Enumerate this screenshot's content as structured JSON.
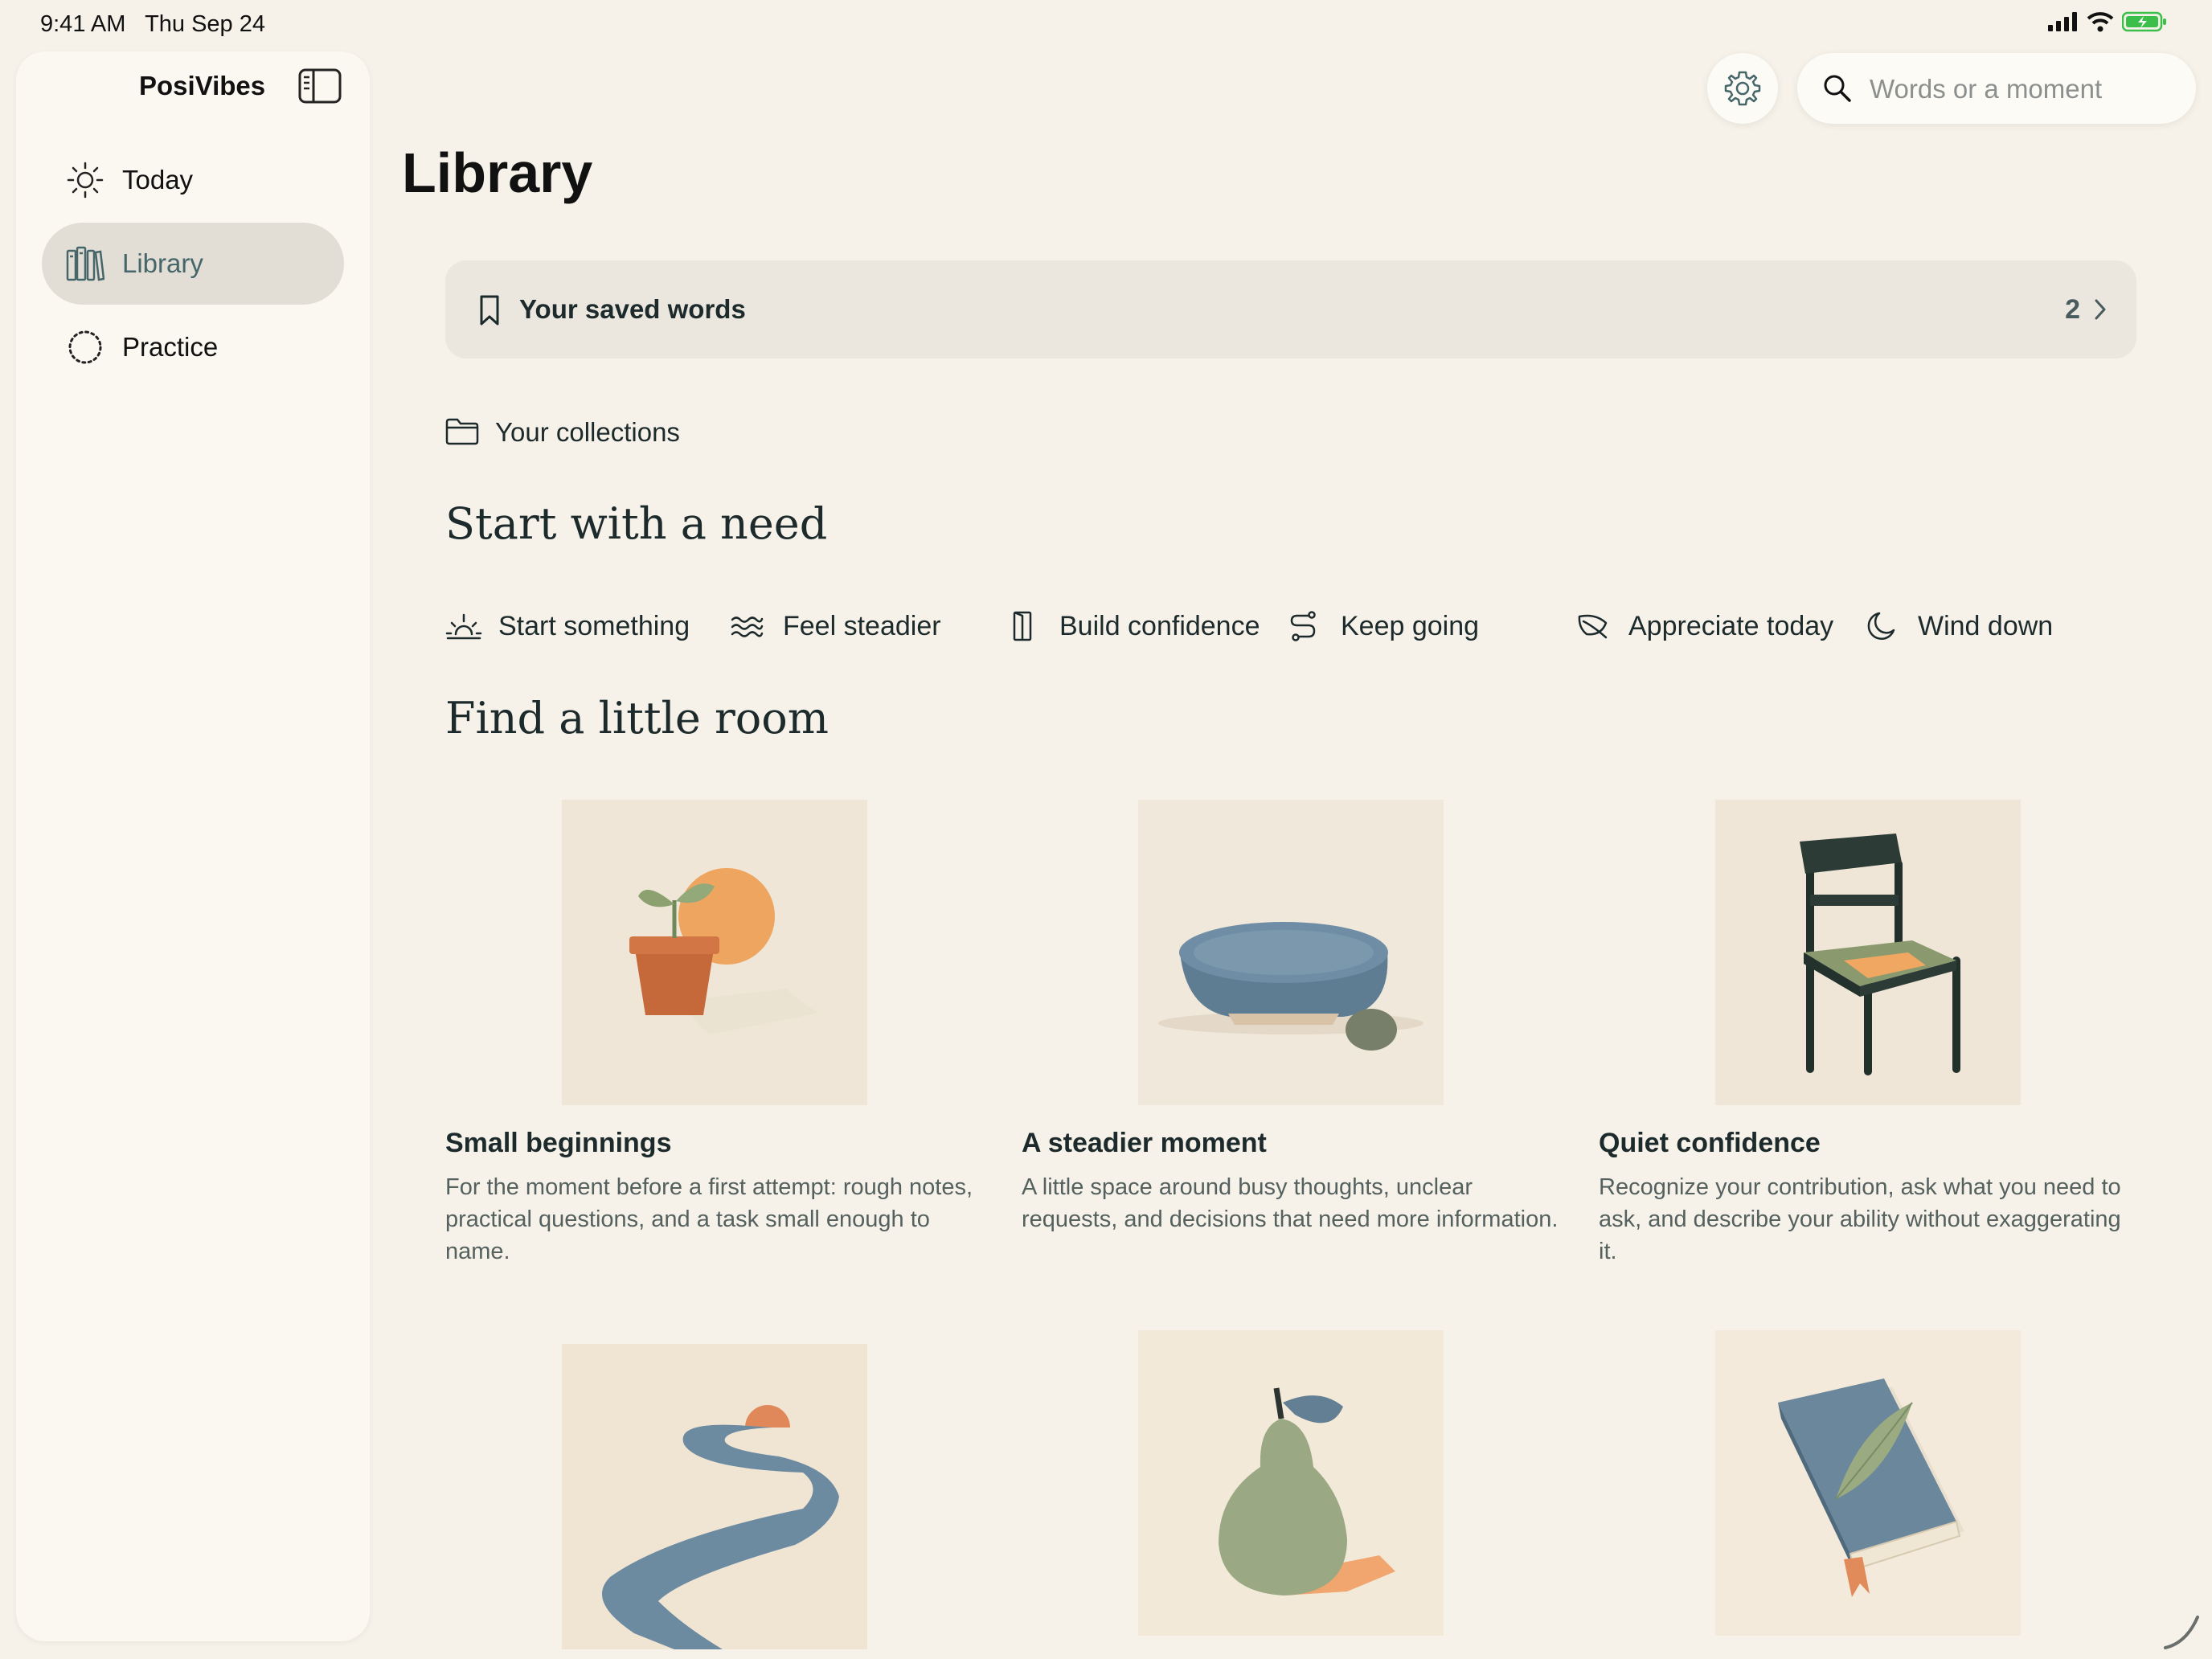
{
  "status_bar": {
    "time": "9:41 AM",
    "date": "Thu Sep 24"
  },
  "sidebar": {
    "app_title": "PosiVibes",
    "items": [
      {
        "label": "Today",
        "icon": "sun-icon"
      },
      {
        "label": "Library",
        "icon": "books-icon",
        "selected": true
      },
      {
        "label": "Practice",
        "icon": "dashed-circle-icon"
      }
    ]
  },
  "search": {
    "placeholder": "Words or a moment"
  },
  "page": {
    "title": "Library"
  },
  "saved_words": {
    "label": "Your saved words",
    "count": "2"
  },
  "collections": {
    "label": "Your collections"
  },
  "needs": {
    "heading": "Start with a need",
    "items": [
      {
        "label": "Start something",
        "icon": "sunrise-icon"
      },
      {
        "label": "Feel steadier",
        "icon": "waves-icon"
      },
      {
        "label": "Build confidence",
        "icon": "door-icon"
      },
      {
        "label": "Keep going",
        "icon": "path-icon"
      },
      {
        "label": "Appreciate today",
        "icon": "leaf-icon"
      },
      {
        "label": "Wind down",
        "icon": "moon-icon"
      }
    ]
  },
  "rooms": {
    "heading": "Find a little room",
    "cards": [
      {
        "title": "Small beginnings",
        "description": "For the moment before a first attempt: rough notes, practical questions, and a task small enough to name.",
        "image": "potted-sprout"
      },
      {
        "title": "A steadier moment",
        "description": "A little space around busy thoughts, unclear requests, and decisions that need more information.",
        "image": "bowl-and-stone"
      },
      {
        "title": "Quiet confidence",
        "description": "Recognize your contribution, ask what you need to ask, and describe your ability without exaggerating it.",
        "image": "chair"
      },
      {
        "title": "",
        "description": "",
        "image": "winding-path"
      },
      {
        "title": "",
        "description": "",
        "image": "pear"
      },
      {
        "title": "",
        "description": "",
        "image": "book-with-leaf"
      }
    ]
  },
  "colors": {
    "accent": "#46666a",
    "background": "#f6f2e9",
    "sidebar": "#fbf8f1",
    "selected": "#e2ded5"
  }
}
